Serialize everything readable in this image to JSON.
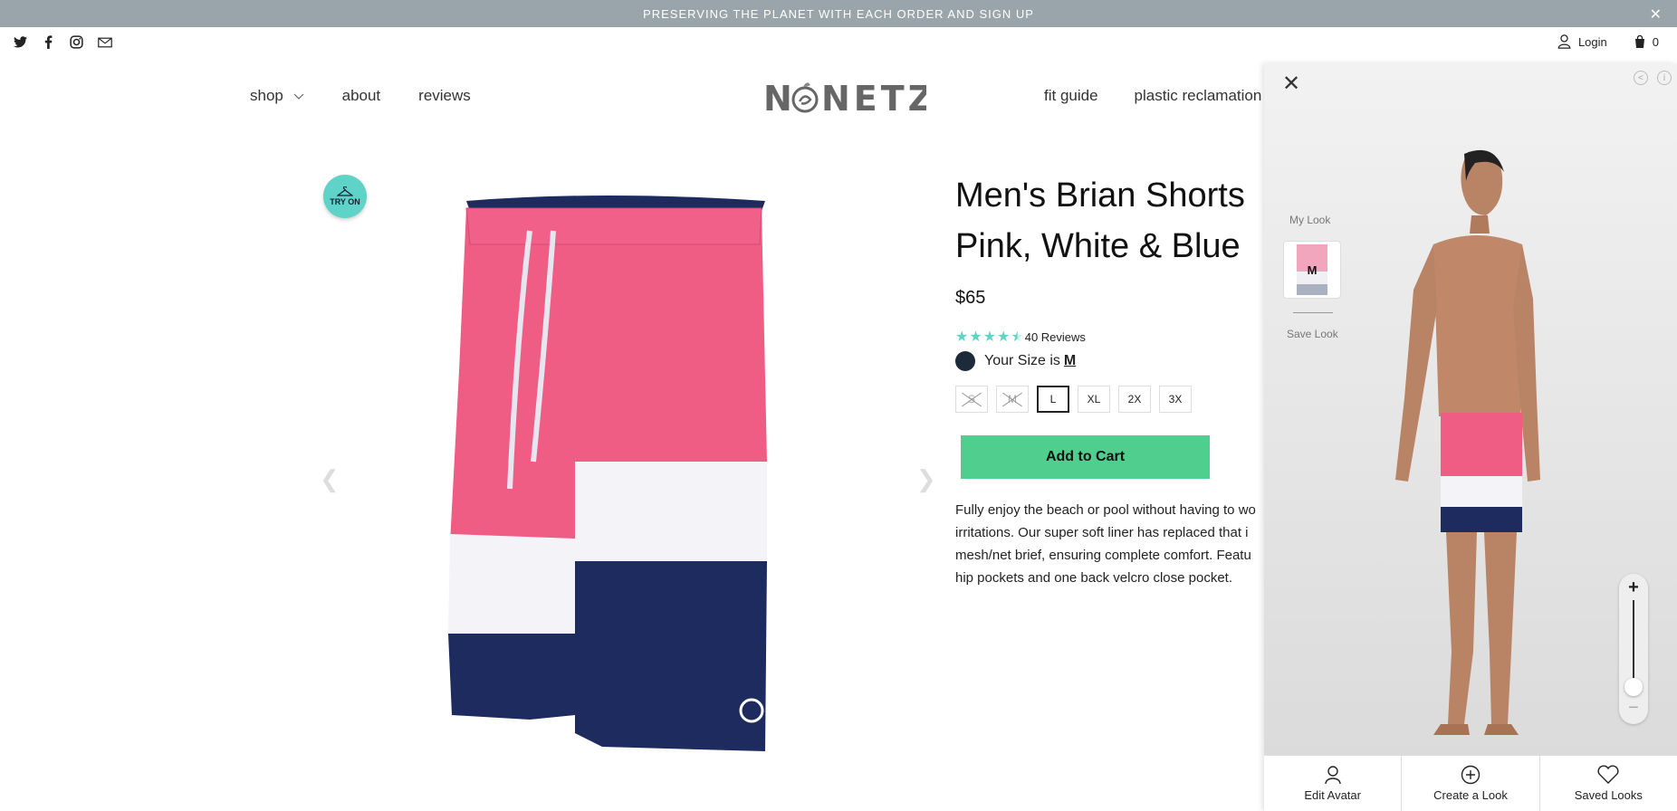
{
  "announcement": {
    "text": "PRESERVING THE PLANET WITH EACH ORDER AND SIGN UP",
    "close": "✕"
  },
  "social": {
    "icons": [
      "twitter-icon",
      "facebook-icon",
      "instagram-icon",
      "mail-icon"
    ]
  },
  "header": {
    "login": "Login",
    "cart_count": "0",
    "logo": "NONETZ",
    "nav_left": [
      "shop",
      "about",
      "reviews"
    ],
    "nav_right": [
      "fit guide",
      "plastic reclamation"
    ]
  },
  "product": {
    "try_on": "TRY ON",
    "prev_arrow": "❮",
    "next_arrow": "❯",
    "title_line1": "Men's Brian Shorts",
    "title_line2": "Pink, White & Blue",
    "price": "$65",
    "rating": 4.5,
    "reviews_label": "40 Reviews",
    "your_size_prefix": "Your Size is",
    "your_size": "M",
    "sizes": [
      {
        "label": "S",
        "state": "disabled"
      },
      {
        "label": "M",
        "state": "disabled"
      },
      {
        "label": "L",
        "state": "selected"
      },
      {
        "label": "XL",
        "state": "available"
      },
      {
        "label": "2X",
        "state": "available"
      },
      {
        "label": "3X",
        "state": "available"
      }
    ],
    "add_to_cart": "Add to Cart",
    "description": "Fully enjoy the beach or pool without having to wo\nirritations. Our super soft liner has replaced that i\nmesh/net brief, ensuring complete comfort. Featu\nhip pockets and one back velcro close pocket.",
    "colors": {
      "pink": "#ef5d85",
      "white": "#f4f3f8",
      "navy": "#1d2b5e",
      "accent": "#4fce8d"
    }
  },
  "tryon_panel": {
    "my_look": "My Look",
    "look_size": "M",
    "save_look": "Save Look",
    "zoom_level": 0.0,
    "bottom": [
      "Edit Avatar",
      "Create a Look",
      "Saved Looks"
    ]
  }
}
